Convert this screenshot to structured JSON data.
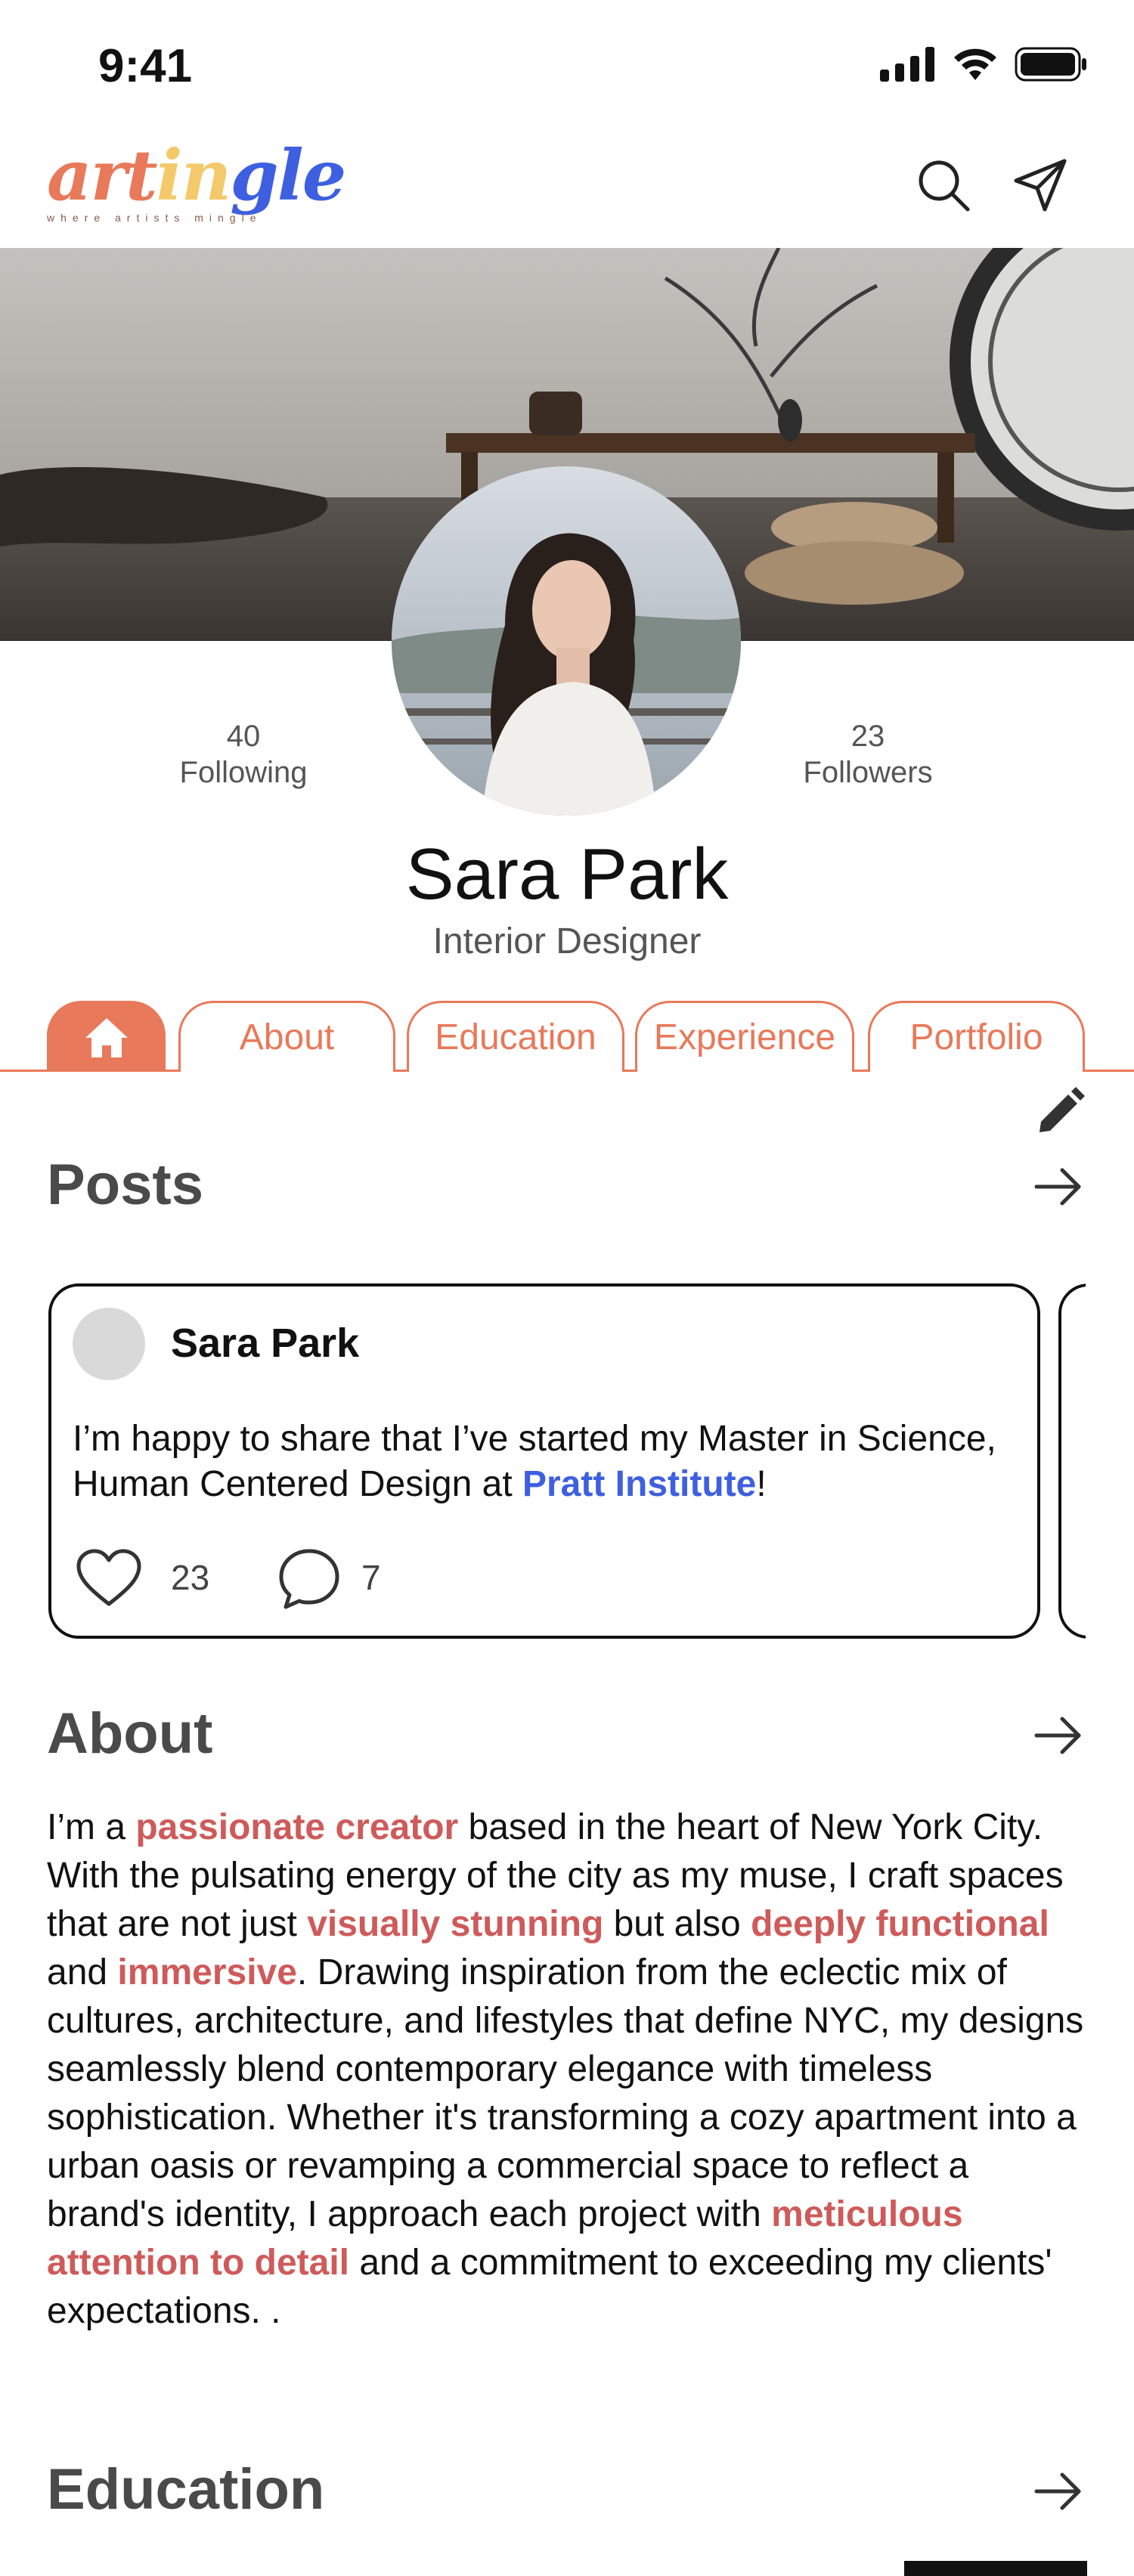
{
  "status_bar": {
    "time": "9:41"
  },
  "brand": {
    "logo_part1": "art",
    "logo_part2": "in",
    "logo_part3": "gle",
    "tagline": "where artists mingle"
  },
  "header_icons": {
    "search": "search-icon",
    "send": "send-icon"
  },
  "profile": {
    "following_count": "40",
    "following_label": "Following",
    "followers_count": "23",
    "followers_label": "Followers",
    "name": "Sara Park",
    "title": "Interior Designer"
  },
  "tabs": [
    {
      "label": "",
      "icon": "home-icon"
    },
    {
      "label": "About"
    },
    {
      "label": "Education"
    },
    {
      "label": "Experience"
    },
    {
      "label": "Portfolio"
    }
  ],
  "posts_section": {
    "title": "Posts",
    "post": {
      "author": "Sara Park",
      "text_before": "I’m happy to share that I’ve started my Master in Science, Human Centered Design at ",
      "text_link": "Pratt Institute",
      "text_after": "!",
      "likes": "23",
      "comments": "7"
    }
  },
  "about_section": {
    "title": "About",
    "p1": "I’m a ",
    "h1": "passionate creator",
    "p2": " based in the heart of New York City. With the pulsating energy of the city as my muse, I craft spaces that are not just ",
    "h2": "visually stunning",
    "p3": " but also ",
    "h3": "deeply functional",
    "p4": " and ",
    "h4": "immersive",
    "p5": ". Drawing inspiration from the eclectic mix of cultures, architecture, and lifestyles that define NYC, my designs seamlessly blend contemporary elegance with timeless sophistication. Whether it's transforming a cozy apartment into a urban oasis or revamping a commercial space to reflect a brand's identity, I approach each project with ",
    "h5": "meticulous attention to detail",
    "p6": " and a commitment to exceeding my clients' expectations. ."
  },
  "education_section": {
    "title": "Education"
  },
  "colors": {
    "accent": "#E8795A",
    "link_blue": "#3E5FE0",
    "highlight_red": "#CF5A5A"
  }
}
